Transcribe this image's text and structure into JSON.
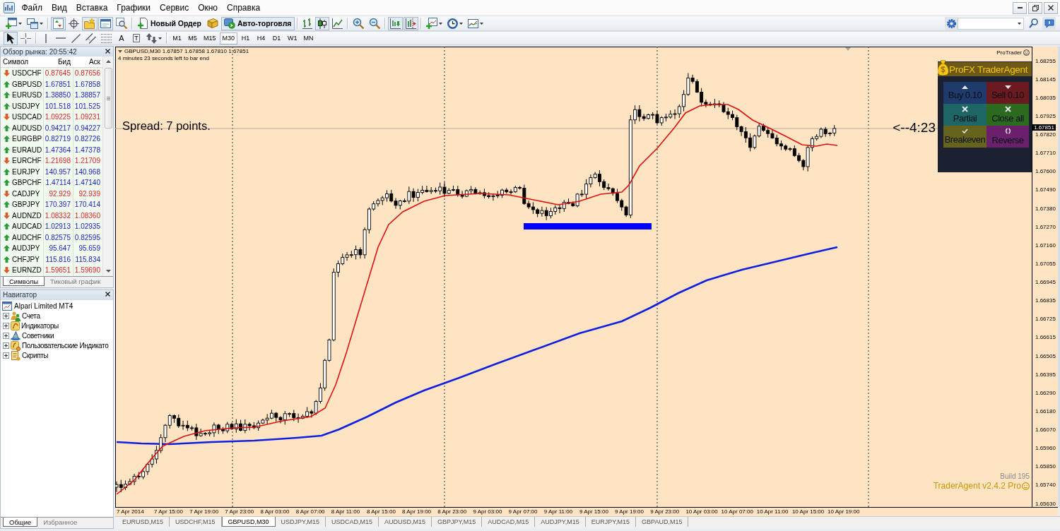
{
  "window": {
    "menu": [
      "Файл",
      "Вид",
      "Вставка",
      "Графики",
      "Сервис",
      "Окно",
      "Справка"
    ]
  },
  "toolbar": {
    "items": [
      {
        "kind": "new-chart",
        "pressed": false,
        "dropdown": true
      },
      {
        "kind": "profiles",
        "pressed": false,
        "dropdown": true
      },
      {
        "kind": "separator"
      },
      {
        "kind": "market-watch",
        "pressed": true,
        "dropdown": false
      },
      {
        "kind": "data-window",
        "pressed": false,
        "dropdown": false
      },
      {
        "kind": "navigator",
        "pressed": true,
        "dropdown": false
      },
      {
        "kind": "terminal",
        "pressed": true,
        "dropdown": false
      },
      {
        "kind": "tester",
        "pressed": false,
        "dropdown": false
      },
      {
        "kind": "separator"
      },
      {
        "kind": "new-order",
        "label": "Новый Ордер",
        "pressed": false,
        "dropdown": false
      },
      {
        "kind": "editor",
        "pressed": false,
        "dropdown": false
      },
      {
        "kind": "auto-trading",
        "label": "Авто-торговля",
        "pressed": true,
        "dropdown": false
      },
      {
        "kind": "separator"
      },
      {
        "kind": "bar-chart",
        "pressed": false,
        "dropdown": false
      },
      {
        "kind": "candle-chart",
        "pressed": true,
        "dropdown": false
      },
      {
        "kind": "line-chart",
        "pressed": false,
        "dropdown": false
      },
      {
        "kind": "separator"
      },
      {
        "kind": "zoom-in",
        "pressed": false,
        "dropdown": false
      },
      {
        "kind": "zoom-out",
        "pressed": false,
        "dropdown": false
      },
      {
        "kind": "separator"
      },
      {
        "kind": "auto-scroll",
        "pressed": true,
        "dropdown": false
      },
      {
        "kind": "chart-shift",
        "pressed": true,
        "dropdown": false
      },
      {
        "kind": "separator"
      },
      {
        "kind": "indicators",
        "pressed": false,
        "dropdown": true
      },
      {
        "kind": "periods",
        "pressed": false,
        "dropdown": true
      },
      {
        "kind": "templates",
        "pressed": false,
        "dropdown": true
      }
    ]
  },
  "drawing_toolbar": {
    "items": [
      {
        "kind": "cursor",
        "pressed": true,
        "dropdown": false
      },
      {
        "kind": "crosshair",
        "pressed": false,
        "dropdown": false
      },
      {
        "kind": "separator"
      },
      {
        "kind": "vertical-line",
        "pressed": false,
        "dropdown": false
      },
      {
        "kind": "horizontal-line",
        "pressed": false,
        "dropdown": false
      },
      {
        "kind": "trendline",
        "pressed": false,
        "dropdown": false
      },
      {
        "kind": "channel",
        "pressed": false,
        "dropdown": false
      },
      {
        "kind": "fibonacci",
        "pressed": false,
        "dropdown": false
      },
      {
        "kind": "text",
        "glyph": "A",
        "pressed": false,
        "dropdown": false
      },
      {
        "kind": "text-label",
        "glyph": "T",
        "pressed": false,
        "dropdown": false
      },
      {
        "kind": "arrows",
        "pressed": false,
        "dropdown": true
      },
      {
        "kind": "separator"
      }
    ]
  },
  "timeframes": [
    {
      "label": "M1",
      "selected": false
    },
    {
      "label": "M5",
      "selected": false
    },
    {
      "label": "M15",
      "selected": false
    },
    {
      "label": "M30",
      "selected": true
    },
    {
      "label": "H1",
      "selected": false
    },
    {
      "label": "H4",
      "selected": false
    },
    {
      "label": "D1",
      "selected": false
    },
    {
      "label": "W1",
      "selected": false
    },
    {
      "label": "MN",
      "selected": false
    }
  ],
  "market_watch": {
    "title": "Обзор рынка: 20:55:42",
    "columns": [
      "Символ",
      "Бид",
      "Аск"
    ],
    "rows": [
      {
        "symbol": "USDCHF",
        "bid": "0.87645",
        "ask": "0.87656",
        "rising": false
      },
      {
        "symbol": "GBPUSD",
        "bid": "1.67851",
        "ask": "1.67858",
        "rising": true
      },
      {
        "symbol": "EURUSD",
        "bid": "1.38850",
        "ask": "1.38857",
        "rising": true
      },
      {
        "symbol": "USDJPY",
        "bid": "101.518",
        "ask": "101.525",
        "rising": true
      },
      {
        "symbol": "USDCAD",
        "bid": "1.09225",
        "ask": "1.09231",
        "rising": false
      },
      {
        "symbol": "AUDUSD",
        "bid": "0.94217",
        "ask": "0.94227",
        "rising": true
      },
      {
        "symbol": "EURGBP",
        "bid": "0.82719",
        "ask": "0.82726",
        "rising": true
      },
      {
        "symbol": "EURAUD",
        "bid": "1.47364",
        "ask": "1.47378",
        "rising": true
      },
      {
        "symbol": "EURCHF",
        "bid": "1.21698",
        "ask": "1.21709",
        "rising": false
      },
      {
        "symbol": "EURJPY",
        "bid": "140.957",
        "ask": "140.968",
        "rising": true
      },
      {
        "symbol": "GBPCHF",
        "bid": "1.47114",
        "ask": "1.47140",
        "rising": true
      },
      {
        "symbol": "CADJPY",
        "bid": "92.929",
        "ask": "92.939",
        "rising": false
      },
      {
        "symbol": "GBPJPY",
        "bid": "170.397",
        "ask": "170.414",
        "rising": true
      },
      {
        "symbol": "AUDNZD",
        "bid": "1.08332",
        "ask": "1.08360",
        "rising": false
      },
      {
        "symbol": "AUDCAD",
        "bid": "1.02913",
        "ask": "1.02935",
        "rising": true
      },
      {
        "symbol": "AUDCHF",
        "bid": "0.82575",
        "ask": "0.82595",
        "rising": true
      },
      {
        "symbol": "AUDJPY",
        "bid": "95.647",
        "ask": "95.659",
        "rising": true
      },
      {
        "symbol": "CHFJPY",
        "bid": "115.816",
        "ask": "115.834",
        "rising": true
      },
      {
        "symbol": "EURNZD",
        "bid": "1.59651",
        "ask": "1.59690",
        "rising": false
      }
    ],
    "tabs": [
      {
        "label": "Символы",
        "selected": true
      },
      {
        "label": "Тиковый график",
        "selected": false
      }
    ]
  },
  "navigator": {
    "title": "Навигатор",
    "tree": [
      {
        "label": "Alpari Limited MT4",
        "kind": "terminal",
        "children": [
          {
            "label": "Счета",
            "kind": "accounts",
            "expanded": false
          },
          {
            "label": "Индикаторы",
            "kind": "indicators",
            "expanded": false
          },
          {
            "label": "Советники",
            "kind": "experts",
            "expanded": false
          },
          {
            "label": "Пользовательские Индикато",
            "kind": "custom-indicators",
            "expanded": false
          },
          {
            "label": "Скрипты",
            "kind": "scripts",
            "expanded": false
          }
        ]
      }
    ],
    "tabs": [
      {
        "label": "Общие",
        "selected": true
      },
      {
        "label": "Избранное",
        "selected": false
      }
    ]
  },
  "chart": {
    "symbol_line": "GBPUSD,M30 1.67857 1.67858 1.67810 1.67851",
    "timer": "4 minutes 23 seconds left to bar end",
    "badge": "ProTrader",
    "spread": "Spread: 7 points.",
    "countdown": "<--4:23",
    "current_price": "1.67851",
    "price_axis": [
      "1.68255",
      "1.68145",
      "1.68035",
      "1.67925",
      "1.67820",
      "1.67710",
      "1.67600",
      "1.67490",
      "1.67380",
      "1.67270",
      "1.67160",
      "1.67055",
      "1.66945",
      "1.66835",
      "1.66725",
      "1.66615",
      "1.66505",
      "1.66395",
      "1.66290",
      "1.66180",
      "1.66070",
      "1.65960",
      "1.65850",
      "1.65740",
      "1.65630"
    ],
    "time_axis": [
      "7 Apr 2014",
      "7 Apr 15:00",
      "7 Apr 19:00",
      "7 Apr 23:00",
      "8 Apr 03:00",
      "8 Apr 07:00",
      "8 Apr 11:00",
      "8 Apr 15:00",
      "8 Apr 19:00",
      "8 Apr 23:00",
      "9 Apr 03:00",
      "9 Apr 07:00",
      "9 Apr 11:00",
      "9 Apr 15:00",
      "9 Apr 19:00",
      "9 Apr 23:00",
      "10 Apr 03:00",
      "10 Apr 07:00",
      "10 Apr 11:00",
      "10 Apr 15:00",
      "10 Apr 19:00"
    ],
    "trade_panel": {
      "title": "ProFX TraderAgent",
      "buttons": [
        {
          "kind": "buy",
          "label": "Buy 0.10",
          "color": "#1f3b6b"
        },
        {
          "kind": "sell",
          "label": "Sell 0.10",
          "color": "#6b1a1f"
        },
        {
          "kind": "partial",
          "label": "Partial",
          "color": "#1e6666"
        },
        {
          "kind": "close-all",
          "label": "Close all",
          "color": "#2c6a1f"
        },
        {
          "kind": "breakeven",
          "label": "Breakeven",
          "color": "#66641c"
        },
        {
          "kind": "reverse",
          "label": "Reverse",
          "color": "#6a206a"
        }
      ]
    },
    "build": "Build 195",
    "version": "TraderAgent v2.4.2 Pro"
  },
  "chart_tabs": [
    {
      "label": "EURUSD,M15",
      "selected": false
    },
    {
      "label": "USDCHF,M15",
      "selected": false
    },
    {
      "label": "GBPUSD,M30",
      "selected": true
    },
    {
      "label": "USDJPY,M15",
      "selected": false
    },
    {
      "label": "USDCAD,M15",
      "selected": false
    },
    {
      "label": "AUDUSD,M15",
      "selected": false
    },
    {
      "label": "GBPJPY,M15",
      "selected": false
    },
    {
      "label": "AUDCAD,M15",
      "selected": false
    },
    {
      "label": "AUDJPY,M15",
      "selected": false
    },
    {
      "label": "EURJPY,M15",
      "selected": false
    },
    {
      "label": "GBPAUD,M15",
      "selected": false
    }
  ]
}
